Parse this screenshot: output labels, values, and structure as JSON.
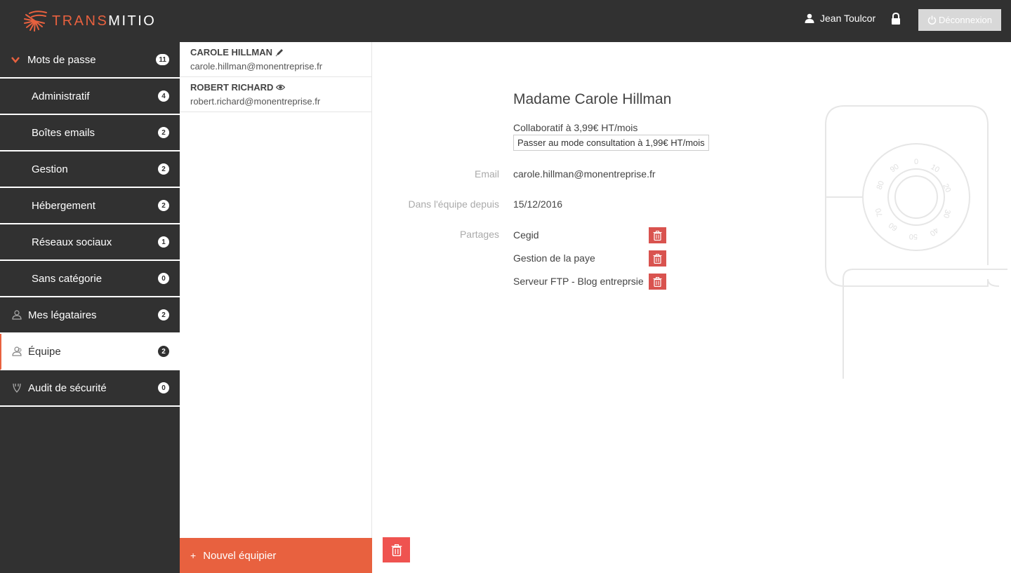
{
  "header": {
    "logo_text_accent": "TRANS",
    "logo_text_rest": "MITIO",
    "user_name": "Jean Toulcor",
    "logout_label": "Déconnexion"
  },
  "sidebar": {
    "items": [
      {
        "label": "Mots de passe",
        "count": "11",
        "icon": "chevron-down-icon"
      },
      {
        "label": "Administratif",
        "count": "4"
      },
      {
        "label": "Boîtes emails",
        "count": "2"
      },
      {
        "label": "Gestion",
        "count": "2"
      },
      {
        "label": "Hébergement",
        "count": "2"
      },
      {
        "label": "Réseaux sociaux",
        "count": "1"
      },
      {
        "label": "Sans catégorie",
        "count": "0"
      },
      {
        "label": "Mes légataires",
        "count": "2",
        "icon": "user-outline-icon"
      },
      {
        "label": "Équipe",
        "count": "2",
        "icon": "team-icon",
        "active": true
      },
      {
        "label": "Audit de sécurité",
        "count": "0",
        "icon": "shield-icon"
      }
    ]
  },
  "members": [
    {
      "name": "CAROLE HILLMAN",
      "email": "carole.hillman@monentreprise.fr",
      "icon": "pencil-icon"
    },
    {
      "name": "ROBERT RICHARD",
      "email": "robert.richard@monentreprise.fr",
      "icon": "eye-icon"
    }
  ],
  "new_member_label": "Nouvel équipier",
  "detail": {
    "title": "Madame Carole Hillman",
    "plan": "Collaboratif à 3,99€ HT/mois",
    "plan_switch_label": "Passer au mode consultation à 1,99€ HT/mois",
    "email_label": "Email",
    "email_value": "carole.hillman@monentreprise.fr",
    "since_label": "Dans l'équipe depuis",
    "since_value": "15/12/2016",
    "shares_label": "Partages",
    "shares": [
      "Cegid",
      "Gestion de la paye",
      "Serveur FTP - Blog entreprsie"
    ]
  },
  "colors": {
    "accent": "#e8613f",
    "dark": "#313131",
    "danger": "#d9534f"
  }
}
